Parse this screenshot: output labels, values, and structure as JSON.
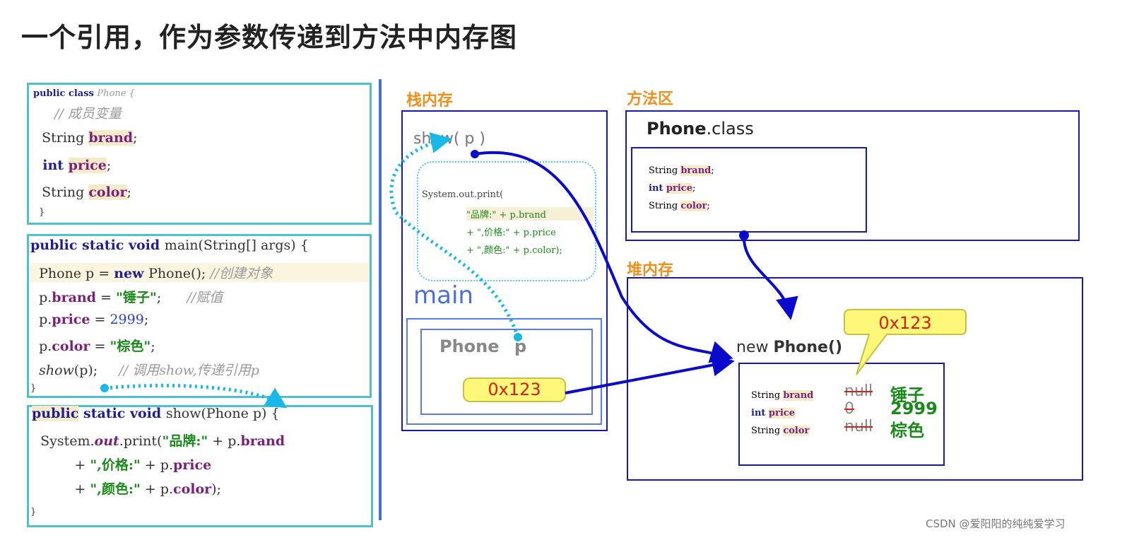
{
  "title": "一个引用，作为参数传递到方法中内存图",
  "code_blocks": [
    [
      [
        {
          "t": "public class ",
          "c": "kw small"
        },
        {
          "t": "Phone {",
          "c": "cm small"
        }
      ],
      [
        {
          "t": "  // 成员变量",
          "c": "cm"
        }
      ],
      [
        {
          "t": "  String ",
          "c": "plain"
        },
        {
          "t": "brand",
          "c": "field hl"
        },
        {
          "t": ";",
          "c": "plain"
        }
      ],
      [
        {
          "t": "  int ",
          "c": "kw"
        },
        {
          "t": "price",
          "c": "field hl"
        },
        {
          "t": ";",
          "c": "plain"
        }
      ],
      [
        {
          "t": "  String ",
          "c": "plain"
        },
        {
          "t": "color",
          "c": "field hl"
        },
        {
          "t": ";",
          "c": "plain"
        }
      ],
      [
        {
          "t": "}",
          "c": "plain small"
        }
      ]
    ],
    [
      [
        {
          "t": "public static void ",
          "c": "kw"
        },
        {
          "t": "main(String[] args) {",
          "c": "plain"
        }
      ],
      [
        {
          "t": "  Phone p = ",
          "c": "plain"
        },
        {
          "t": "new ",
          "c": "kw"
        },
        {
          "t": "Phone(); ",
          "c": "plain"
        },
        {
          "t": "//创建对象",
          "c": "cm"
        }
      ],
      [
        {
          "t": "  p.",
          "c": "plain"
        },
        {
          "t": "brand",
          "c": "field"
        },
        {
          "t": " = ",
          "c": "plain"
        },
        {
          "t": "\"锤子\"",
          "c": "str"
        },
        {
          "t": ";      ",
          "c": "plain"
        },
        {
          "t": "//赋值",
          "c": "cm"
        }
      ],
      [
        {
          "t": "  p.",
          "c": "plain"
        },
        {
          "t": "price",
          "c": "field"
        },
        {
          "t": " = ",
          "c": "plain"
        },
        {
          "t": "2999",
          "c": "num"
        },
        {
          "t": ";",
          "c": "plain"
        }
      ],
      [
        {
          "t": "  p.",
          "c": "plain"
        },
        {
          "t": "color",
          "c": "field"
        },
        {
          "t": " = ",
          "c": "plain"
        },
        {
          "t": "\"棕色\"",
          "c": "str"
        },
        {
          "t": ";",
          "c": "plain"
        }
      ],
      [
        {
          "t": "  ",
          "c": "plain"
        },
        {
          "t": "show",
          "c": "it"
        },
        {
          "t": "(p);     ",
          "c": "plain"
        },
        {
          "t": "// 调用show,传递引用p",
          "c": "cm"
        }
      ],
      [
        {
          "t": "}",
          "c": "plain small"
        }
      ]
    ],
    [
      [
        {
          "t": "public",
          "c": "kw hl"
        },
        {
          "t": " static void ",
          "c": "kw"
        },
        {
          "t": "show(Phone p) {",
          "c": "plain"
        }
      ],
      [
        {
          "t": "  System.",
          "c": "plain"
        },
        {
          "t": "out",
          "c": "field it"
        },
        {
          "t": ".print(",
          "c": "plain"
        },
        {
          "t": "\"品牌:\"",
          "c": "str"
        },
        {
          "t": " + p.",
          "c": "plain"
        },
        {
          "t": "brand",
          "c": "field"
        }
      ],
      [
        {
          "t": "          + ",
          "c": "plain"
        },
        {
          "t": "\",价格:\"",
          "c": "str"
        },
        {
          "t": " + p.",
          "c": "plain"
        },
        {
          "t": "price",
          "c": "field"
        }
      ],
      [
        {
          "t": "          + ",
          "c": "plain"
        },
        {
          "t": "\",颜色:\"",
          "c": "str"
        },
        {
          "t": " + p.",
          "c": "plain"
        },
        {
          "t": "color",
          "c": "field"
        },
        {
          "t": ");",
          "c": "plain"
        }
      ],
      [
        {
          "t": "}",
          "c": "plain small"
        }
      ]
    ]
  ],
  "stack": {
    "label": "栈内存",
    "show_frame": "show( p )",
    "print_lines": [
      "System.out.print(",
      "\"品牌:\" + p.brand",
      "+ \",价格:\" + p.price",
      "+ \",颜色:\" + p.color);"
    ],
    "main_frame": "main",
    "var_type": "Phone",
    "var_name": "p",
    "var_value": "0x123"
  },
  "method_area": {
    "label": "方法区",
    "class_name": "Phone",
    "class_suffix": ".class",
    "fields": [
      [
        "String ",
        "brand",
        ";"
      ],
      [
        "int ",
        "price",
        ";"
      ],
      [
        "String ",
        "color",
        ";"
      ]
    ]
  },
  "heap": {
    "label": "堆内存",
    "new_prefix": "new ",
    "new_class": "Phone()",
    "address": "0x123",
    "fields": [
      {
        "decl": "String ",
        "name": "brand",
        "default": "null",
        "value": "锤子"
      },
      {
        "decl": "int ",
        "name": "price",
        "default": "0",
        "value": "2999"
      },
      {
        "decl": "String ",
        "name": "color",
        "default": "null",
        "value": "棕色"
      }
    ]
  },
  "watermark": "CSDN @爱阳阳的纯纯爱学习",
  "colors": {
    "accent_orange": "#f0901a",
    "box_blue": "#1a1aaa",
    "arrow_blue": "#0a0acc",
    "dotted_cyan": "#1ab8e8",
    "code_border": "#4fc1c9"
  }
}
